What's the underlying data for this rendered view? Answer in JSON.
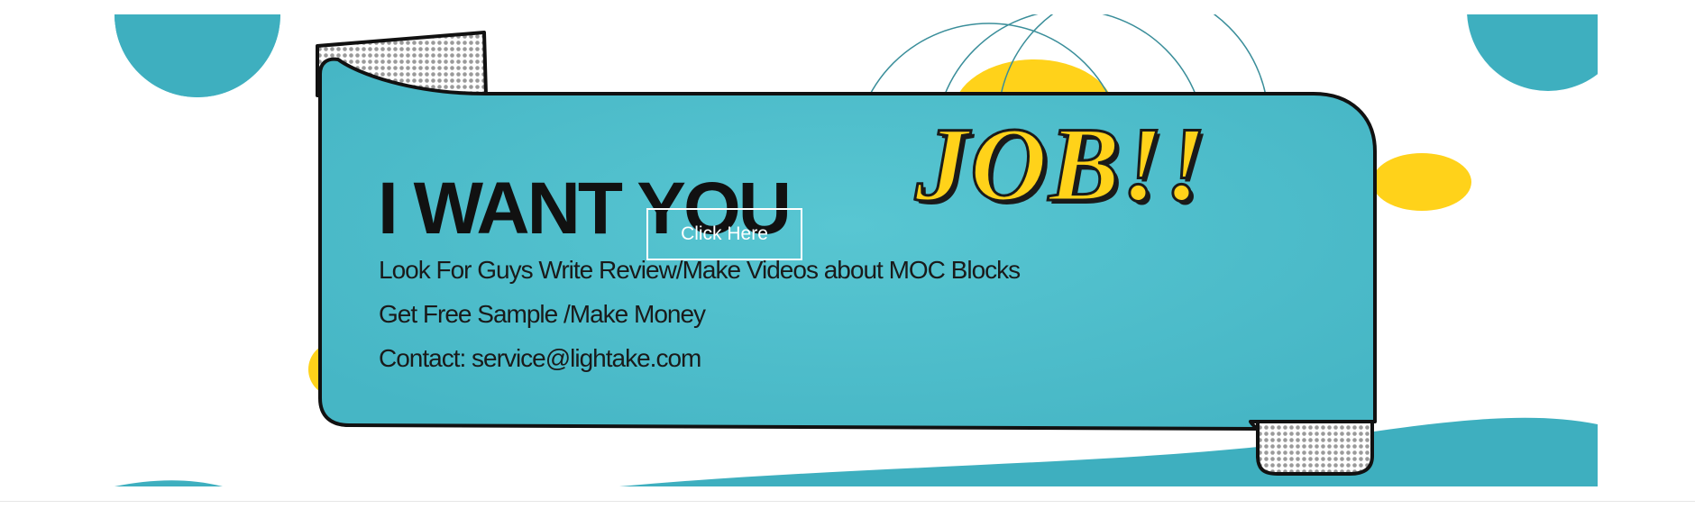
{
  "banner": {
    "headline": "I WANT YOU",
    "job_text": "JOB!!",
    "lines": [
      "Look For Guys Write Review/Make Videos about MOC Blocks",
      "Get Free Sample /Make Money",
      "Contact: service@lightake.com"
    ],
    "cta_label": "Click Here"
  },
  "colors": {
    "teal": "#4dbcca",
    "teal_dark": "#36a7b7",
    "yellow": "#ffd21a",
    "outline": "#111111"
  }
}
